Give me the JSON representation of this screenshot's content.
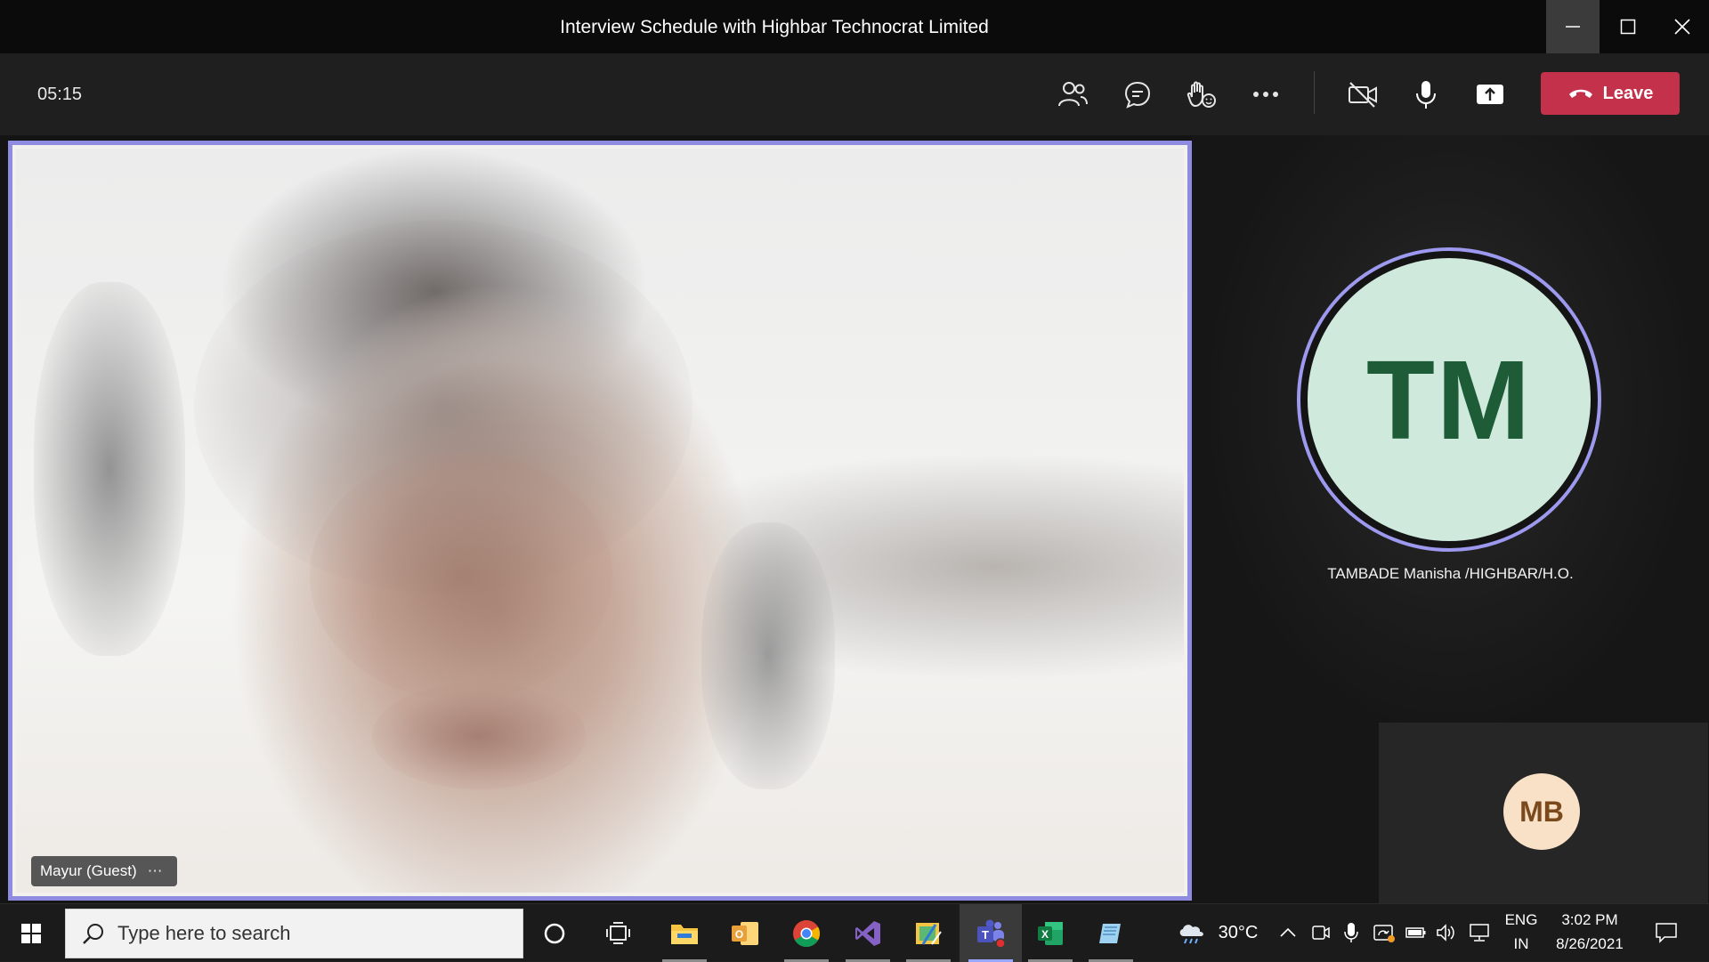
{
  "window": {
    "title": "Interview Schedule with Highbar Technocrat Limited"
  },
  "toolbar": {
    "timer": "05:15",
    "leave_label": "Leave",
    "icons": [
      "participants-icon",
      "chat-icon",
      "reactions-icon",
      "more-options-icon",
      "camera-off-icon",
      "microphone-icon",
      "share-screen-icon"
    ]
  },
  "stage": {
    "main_video": {
      "participant_name": "Mayur (Guest)",
      "more_label": "⋯"
    },
    "featured_participant": {
      "initials": "TM",
      "name": "TAMBADE Manisha /HIGHBAR/H.O.",
      "avatar_bg": "#cfe9dc",
      "avatar_fg": "#1d5c37",
      "ring_color": "#9d99ee"
    },
    "small_participant": {
      "initials": "MB",
      "avatar_bg": "#f9e1c7",
      "avatar_fg": "#7a4a1c"
    },
    "active_border_color": "#8f8be0"
  },
  "taskbar": {
    "search_placeholder": "Type here to search",
    "apps": [
      "cortana",
      "task-view",
      "file-explorer",
      "outlook",
      "chrome",
      "visual-studio",
      "snip-tool",
      "teams",
      "excel",
      "notepad"
    ],
    "weather_temp": "30°C",
    "language_line1": "ENG",
    "language_line2": "IN",
    "time": "3:02 PM",
    "date": "8/26/2021"
  },
  "colors": {
    "leave_button": "#c4314b",
    "titlebar_bg": "#0b0b0b",
    "toolbar_bg": "#1f1f1f"
  }
}
